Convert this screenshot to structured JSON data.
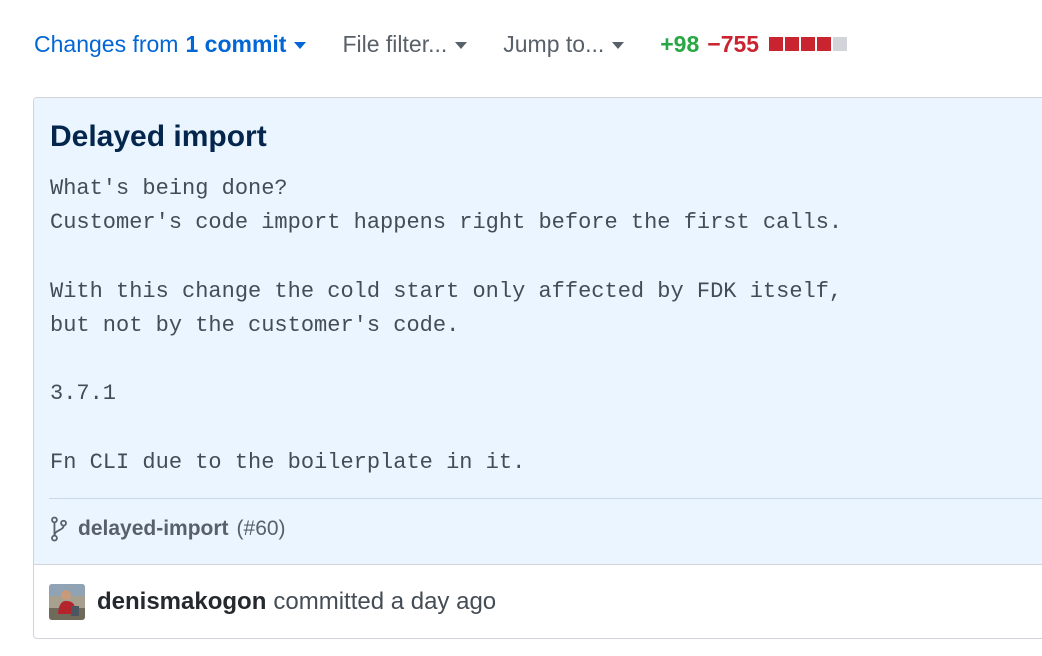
{
  "toolbar": {
    "changes_prefix": "Changes from",
    "changes_count": "1 commit",
    "file_filter": "File filter...",
    "jump_to": "Jump to...",
    "additions": "+98",
    "deletions": "−755",
    "diffstat_blocks": [
      "deleted",
      "deleted",
      "deleted",
      "deleted",
      "neutral"
    ]
  },
  "commit": {
    "title": "Delayed import",
    "description_lines": [
      "What's being done?",
      "Customer's code import happens right before the first calls.",
      "",
      "With this change the cold start only affected by FDK itself,",
      "but not by the customer's code.",
      "",
      "3.7.1",
      "",
      "Fn CLI due to the boilerplate in it."
    ],
    "branch": "delayed-import",
    "pr_ref": "(#60)",
    "author": "denismakogon",
    "action": "committed a day ago"
  },
  "colors": {
    "link": "#0366d6",
    "added": "#28a745",
    "deleted": "#cb2431",
    "header_bg": "#eaf5ff",
    "title": "#05264c"
  }
}
